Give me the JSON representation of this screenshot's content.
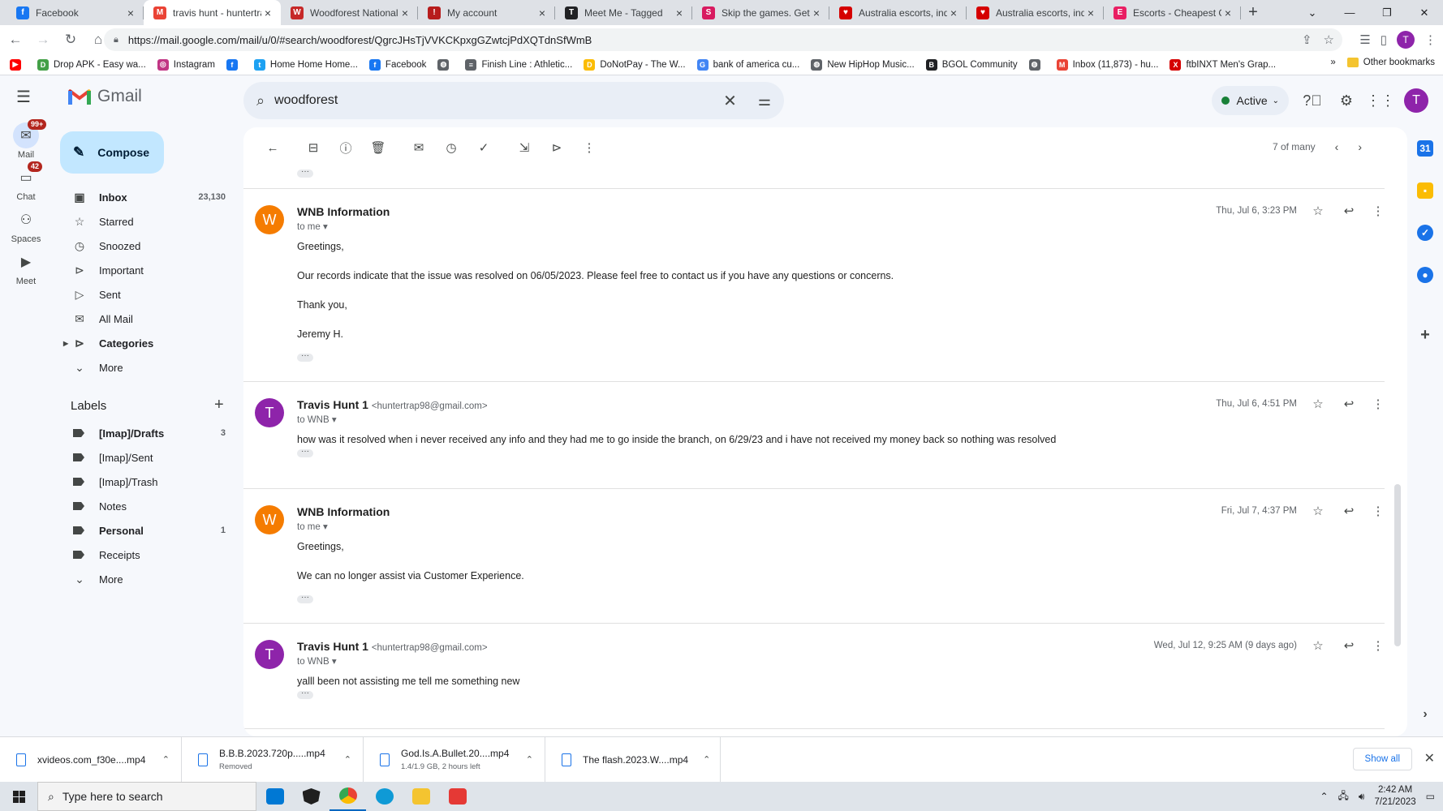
{
  "browser": {
    "tabs": [
      {
        "title": "Facebook",
        "color": "#1877f2",
        "glyph": "f"
      },
      {
        "title": "travis hunt - huntertra",
        "color": "#ea4335",
        "glyph": "M",
        "active": true
      },
      {
        "title": "Woodforest National",
        "color": "#c62828",
        "glyph": "W"
      },
      {
        "title": "My account",
        "color": "#b71c1c",
        "glyph": "!"
      },
      {
        "title": "Meet Me - Tagged",
        "color": "#202124",
        "glyph": "T"
      },
      {
        "title": "Skip the games. Get S",
        "color": "#d81b60",
        "glyph": "S"
      },
      {
        "title": "Australia escorts, indi",
        "color": "#d50000",
        "glyph": "♥"
      },
      {
        "title": "Australia escorts, indi",
        "color": "#d50000",
        "glyph": "♥"
      },
      {
        "title": "Escorts - Cheapest GF",
        "color": "#e91e63",
        "glyph": "E"
      }
    ],
    "url": "https://mail.google.com/mail/u/0/#search/woodforest/QgrcJHsTjVVKCKpxgGZwtcjPdXQTdnSfWmB",
    "profile_initial": "T",
    "bookmarks": [
      {
        "label": "",
        "color": "#ff0000",
        "glyph": "▶"
      },
      {
        "label": "Drop APK - Easy wa...",
        "color": "#43a047",
        "glyph": "D"
      },
      {
        "label": "Instagram",
        "color": "#c13584",
        "glyph": "◎"
      },
      {
        "label": "",
        "color": "#1877f2",
        "glyph": "f"
      },
      {
        "label": "Home Home Home...",
        "color": "#1da1f2",
        "glyph": "t"
      },
      {
        "label": "Facebook",
        "color": "#1877f2",
        "glyph": "f"
      },
      {
        "label": "",
        "color": "#5f6368",
        "glyph": "◍"
      },
      {
        "label": "Finish Line : Athletic...",
        "color": "#5f6368",
        "glyph": "≡"
      },
      {
        "label": "DoNotPay - The W...",
        "color": "#fbbc04",
        "glyph": "D"
      },
      {
        "label": "bank of america cu...",
        "color": "#4285f4",
        "glyph": "G"
      },
      {
        "label": "New HipHop Music...",
        "color": "#5f6368",
        "glyph": "◍"
      },
      {
        "label": "BGOL Community",
        "color": "#202124",
        "glyph": "B"
      },
      {
        "label": "",
        "color": "#5f6368",
        "glyph": "◍"
      },
      {
        "label": "Inbox (11,873) - hu...",
        "color": "#ea4335",
        "glyph": "M"
      },
      {
        "label": "ftbINXT Men's Grap...",
        "color": "#d50000",
        "glyph": "X"
      }
    ],
    "other_bookmarks": "Other bookmarks",
    "more_glyph": "»"
  },
  "gmail": {
    "product": "Gmail",
    "rail": [
      {
        "label": "Mail",
        "badge": "99+",
        "icon": "mail-icon"
      },
      {
        "label": "Chat",
        "badge": "42",
        "icon": "chat-icon"
      },
      {
        "label": "Spaces",
        "badge": "",
        "icon": "spaces-icon"
      },
      {
        "label": "Meet",
        "badge": "",
        "icon": "meet-icon"
      }
    ],
    "search_value": "woodforest",
    "status": "Active",
    "compose": "Compose",
    "nav": [
      {
        "label": "Inbox",
        "count": "23,130",
        "bold": true,
        "glyph": "▣"
      },
      {
        "label": "Starred",
        "count": "",
        "glyph": "☆"
      },
      {
        "label": "Snoozed",
        "count": "",
        "glyph": "◷"
      },
      {
        "label": "Important",
        "count": "",
        "glyph": "⊳"
      },
      {
        "label": "Sent",
        "count": "",
        "glyph": "▷"
      },
      {
        "label": "All Mail",
        "count": "",
        "glyph": "✉"
      },
      {
        "label": "Categories",
        "count": "",
        "bold": true,
        "glyph": "⊳"
      },
      {
        "label": "More",
        "count": "",
        "glyph": "⌄"
      }
    ],
    "labels_heading": "Labels",
    "labels": [
      {
        "label": "[Imap]/Drafts",
        "count": "3",
        "bold": true
      },
      {
        "label": "[Imap]/Sent",
        "count": ""
      },
      {
        "label": "[Imap]/Trash",
        "count": ""
      },
      {
        "label": "Notes",
        "count": ""
      },
      {
        "label": "Personal",
        "count": "1",
        "bold": true
      },
      {
        "label": "Receipts",
        "count": ""
      },
      {
        "label": "More",
        "count": ""
      }
    ],
    "pager": "7 of many",
    "messages": [
      {
        "initial": "W",
        "color": "#f57c00",
        "sender": "WNB Information",
        "address": "",
        "to": "to me",
        "date": "Thu, Jul 6, 3:23 PM",
        "body": [
          "Greetings,",
          "Our records indicate that the issue was resolved on 06/05/2023. Please feel free to contact us if you have any questions or concerns.",
          "Thank you,",
          "Jeremy H."
        ]
      },
      {
        "initial": "T",
        "color": "#8e24aa",
        "sender": "Travis Hunt 1",
        "address": "<huntertrap98@gmail.com>",
        "to": "to WNB",
        "date": "Thu, Jul 6, 4:51 PM",
        "body": [
          "how was it resolved when i never received any info and they had me to go inside the branch, on 6/29/23 and i have not received my money back so nothing was resolved"
        ]
      },
      {
        "initial": "W",
        "color": "#f57c00",
        "sender": "WNB Information",
        "address": "",
        "to": "to me",
        "date": "Fri, Jul 7, 4:37 PM",
        "body": [
          "Greetings,",
          "We can no longer assist via Customer Experience."
        ]
      },
      {
        "initial": "T",
        "color": "#8e24aa",
        "sender": "Travis Hunt 1",
        "address": "<huntertrap98@gmail.com>",
        "to": "to WNB",
        "date": "Wed, Jul 12, 9:25 AM (9 days ago)",
        "body": [
          "yalll been not assisting me tell me something new"
        ]
      }
    ]
  },
  "downloads": [
    {
      "name": "xvideos.com_f30e....mp4",
      "sub": ""
    },
    {
      "name": "B.B.B.2023.720p.....mp4",
      "sub": "Removed"
    },
    {
      "name": "God.Is.A.Bullet.20....mp4",
      "sub": "1.4/1.9 GB, 2 hours left"
    },
    {
      "name": "The flash.2023.W....mp4",
      "sub": ""
    }
  ],
  "show_all": "Show all",
  "taskbar": {
    "search_placeholder": "Type here to search",
    "time": "2:42 AM",
    "date": "7/21/2023"
  }
}
